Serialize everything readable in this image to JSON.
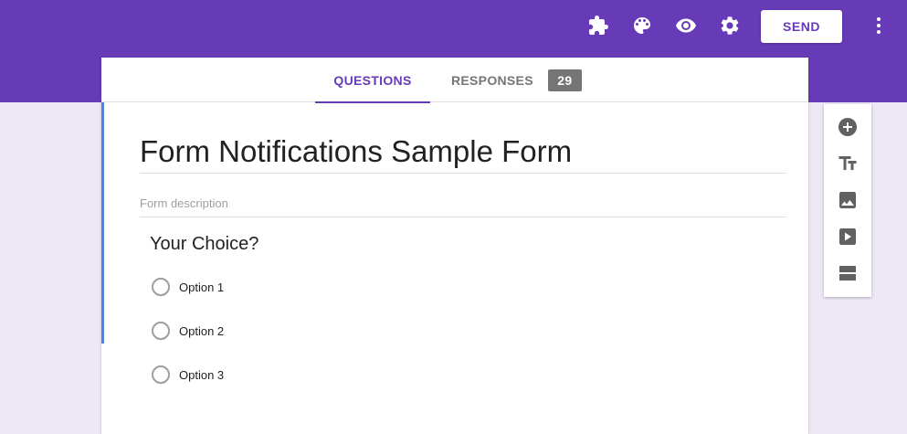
{
  "header": {
    "icons": [
      "addons-icon",
      "palette-icon",
      "preview-eye-icon",
      "settings-gear-icon",
      "more-vert-icon"
    ],
    "send_label": "SEND",
    "brand_color": "#673ab7"
  },
  "tabs": {
    "questions_label": "QUESTIONS",
    "responses_label": "RESPONSES",
    "responses_count": "29"
  },
  "form": {
    "title": "Form Notifications Sample Form",
    "description_placeholder": "Form description"
  },
  "question": {
    "title": "Your Choice?",
    "options": [
      "Option 1",
      "Option 2",
      "Option 3"
    ]
  },
  "side_toolbar": {
    "tools": [
      "add-question-icon",
      "add-title-icon",
      "add-image-icon",
      "add-video-icon",
      "add-section-icon"
    ]
  }
}
